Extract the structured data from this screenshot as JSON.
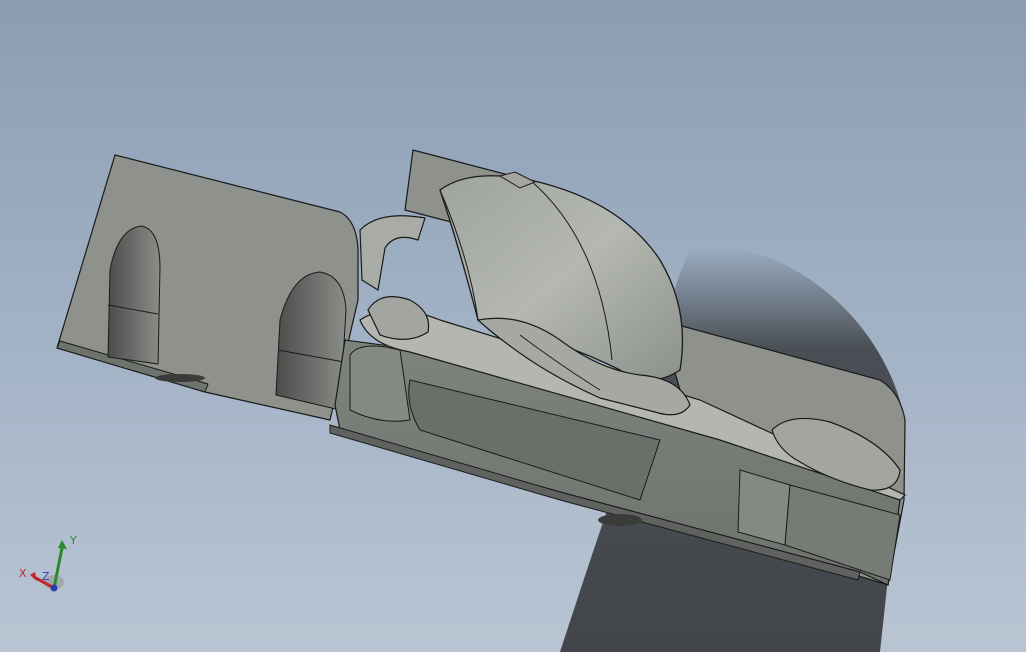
{
  "viewport": {
    "background_top": "#8b9db3",
    "background_bottom": "#b9c5d3",
    "model_color": "#9a9d98",
    "edge_color": "#1a1a1a",
    "shadow_color": "#2e3033"
  },
  "triad": {
    "x_label": "X",
    "y_label": "Y",
    "z_label": "Z",
    "x_color": "#c0282a",
    "y_color": "#2a8a2e",
    "z_color": "#2a3fb0"
  }
}
